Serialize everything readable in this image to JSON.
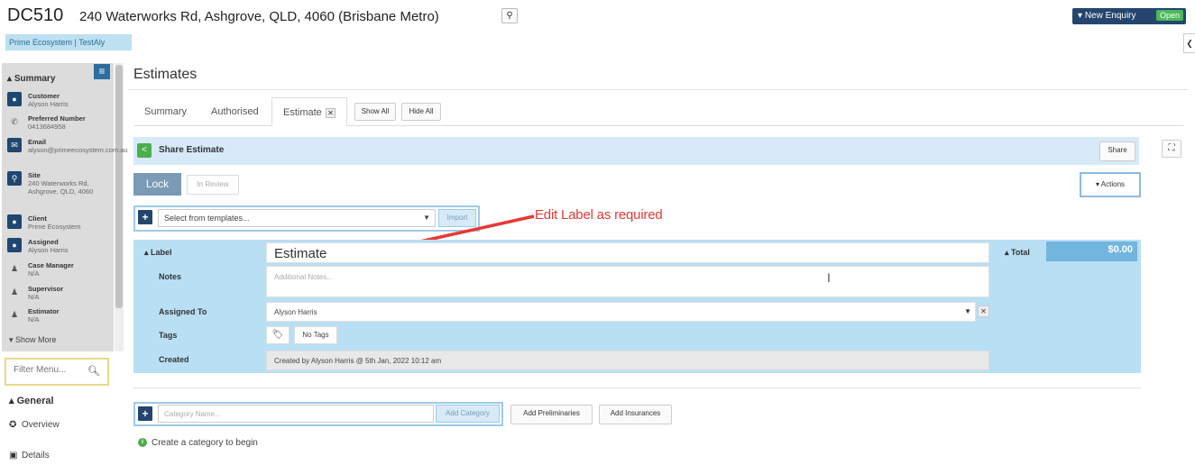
{
  "header": {
    "job_code": "DC510",
    "address": "240 Waterworks Rd, Ashgrove, QLD, 4060 (Brisbane Metro)",
    "enquiry_label": "New Enquiry",
    "status": "Open",
    "org": "Prime Ecosystem | TestAly"
  },
  "sidebar": {
    "summary_label": "Summary",
    "items": [
      {
        "label": "Customer",
        "value": "Alyson Harris",
        "icon": "user-icon"
      },
      {
        "label": "Preferred Number",
        "value": "0413684958",
        "icon": "phone-icon"
      },
      {
        "label": "Email",
        "value": "alyson@primeecosystem.com.au",
        "icon": "email-icon"
      },
      {
        "label": "Site",
        "value": "240 Waterworks Rd, Ashgrove, QLD, 4060",
        "icon": "map-pin-icon"
      },
      {
        "label": "Client",
        "value": "Prime Ecosystem",
        "icon": "user-icon"
      },
      {
        "label": "Assigned",
        "value": "Alyson Harris",
        "icon": "user-icon"
      },
      {
        "label": "Case Manager",
        "value": "N/A",
        "icon": "person-icon"
      },
      {
        "label": "Supervisor",
        "value": "N/A",
        "icon": "person-icon"
      },
      {
        "label": "Estimator",
        "value": "N/A",
        "icon": "person-icon"
      }
    ],
    "show_more": "Show More",
    "filter_placeholder": "Filter Menu...",
    "general_label": "General",
    "nav": [
      {
        "label": "Overview",
        "icon": "overview-icon"
      },
      {
        "label": "Details",
        "icon": "details-icon"
      }
    ]
  },
  "main": {
    "title": "Estimates",
    "tabs": [
      "Summary",
      "Authorised",
      "Estimate"
    ],
    "show_all": "Show All",
    "hide_all": "Hide All",
    "share_title": "Share Estimate",
    "share_btn": "Share",
    "lock_btn": "Lock",
    "review_btn": "In Review",
    "actions_btn": "Actions",
    "template_placeholder": "Select from templates...",
    "import_btn": "Import",
    "annotation": "Edit Label as required",
    "label_label": "Label",
    "label_value": "Estimate",
    "notes_label": "Notes",
    "notes_placeholder": "Additional Notes...",
    "assigned_label": "Assigned To",
    "assigned_value": "Alyson Harris",
    "tags_label": "Tags",
    "tags_btn": "No Tags",
    "created_label": "Created",
    "created_value": "Created by Alyson Harris @ 5th Jan, 2022 10:12 am",
    "total_label": "Total",
    "total_value": "$0.00",
    "category_placeholder": "Category Name...",
    "add_category": "Add Category",
    "add_preliminaries": "Add Preliminaries",
    "add_insurances": "Add Insurances",
    "hint": "Create a category to begin"
  },
  "colors": {
    "navy": "#24466e",
    "panel_blue": "#b9dff4",
    "total_blue": "#72b5df",
    "annotation_red": "#e53935",
    "open_green": "#4cb85a"
  }
}
